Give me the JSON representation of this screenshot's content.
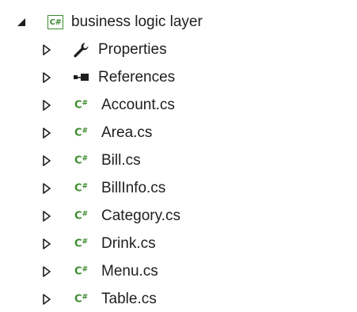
{
  "colors": {
    "text": "#1e1e1e",
    "csharp_green": "#3c8a2e",
    "expander": "#1e1e1e",
    "background": "#ffffff"
  },
  "tree": {
    "project": {
      "label": "business logic layer",
      "icon": "csharp-project-icon",
      "icon_text": "C#",
      "expanded": true
    },
    "items": [
      {
        "label": "Properties",
        "icon": "wrench-icon",
        "expanded": false
      },
      {
        "label": "References",
        "icon": "references-icon",
        "expanded": false
      },
      {
        "label": "Account.cs",
        "icon": "csharp-file-icon",
        "expanded": false
      },
      {
        "label": "Area.cs",
        "icon": "csharp-file-icon",
        "expanded": false
      },
      {
        "label": "Bill.cs",
        "icon": "csharp-file-icon",
        "expanded": false
      },
      {
        "label": "BillInfo.cs",
        "icon": "csharp-file-icon",
        "expanded": false
      },
      {
        "label": "Category.cs",
        "icon": "csharp-file-icon",
        "expanded": false
      },
      {
        "label": "Drink.cs",
        "icon": "csharp-file-icon",
        "expanded": false
      },
      {
        "label": "Menu.cs",
        "icon": "csharp-file-icon",
        "expanded": false
      },
      {
        "label": "Table.cs",
        "icon": "csharp-file-icon",
        "expanded": false
      }
    ]
  }
}
